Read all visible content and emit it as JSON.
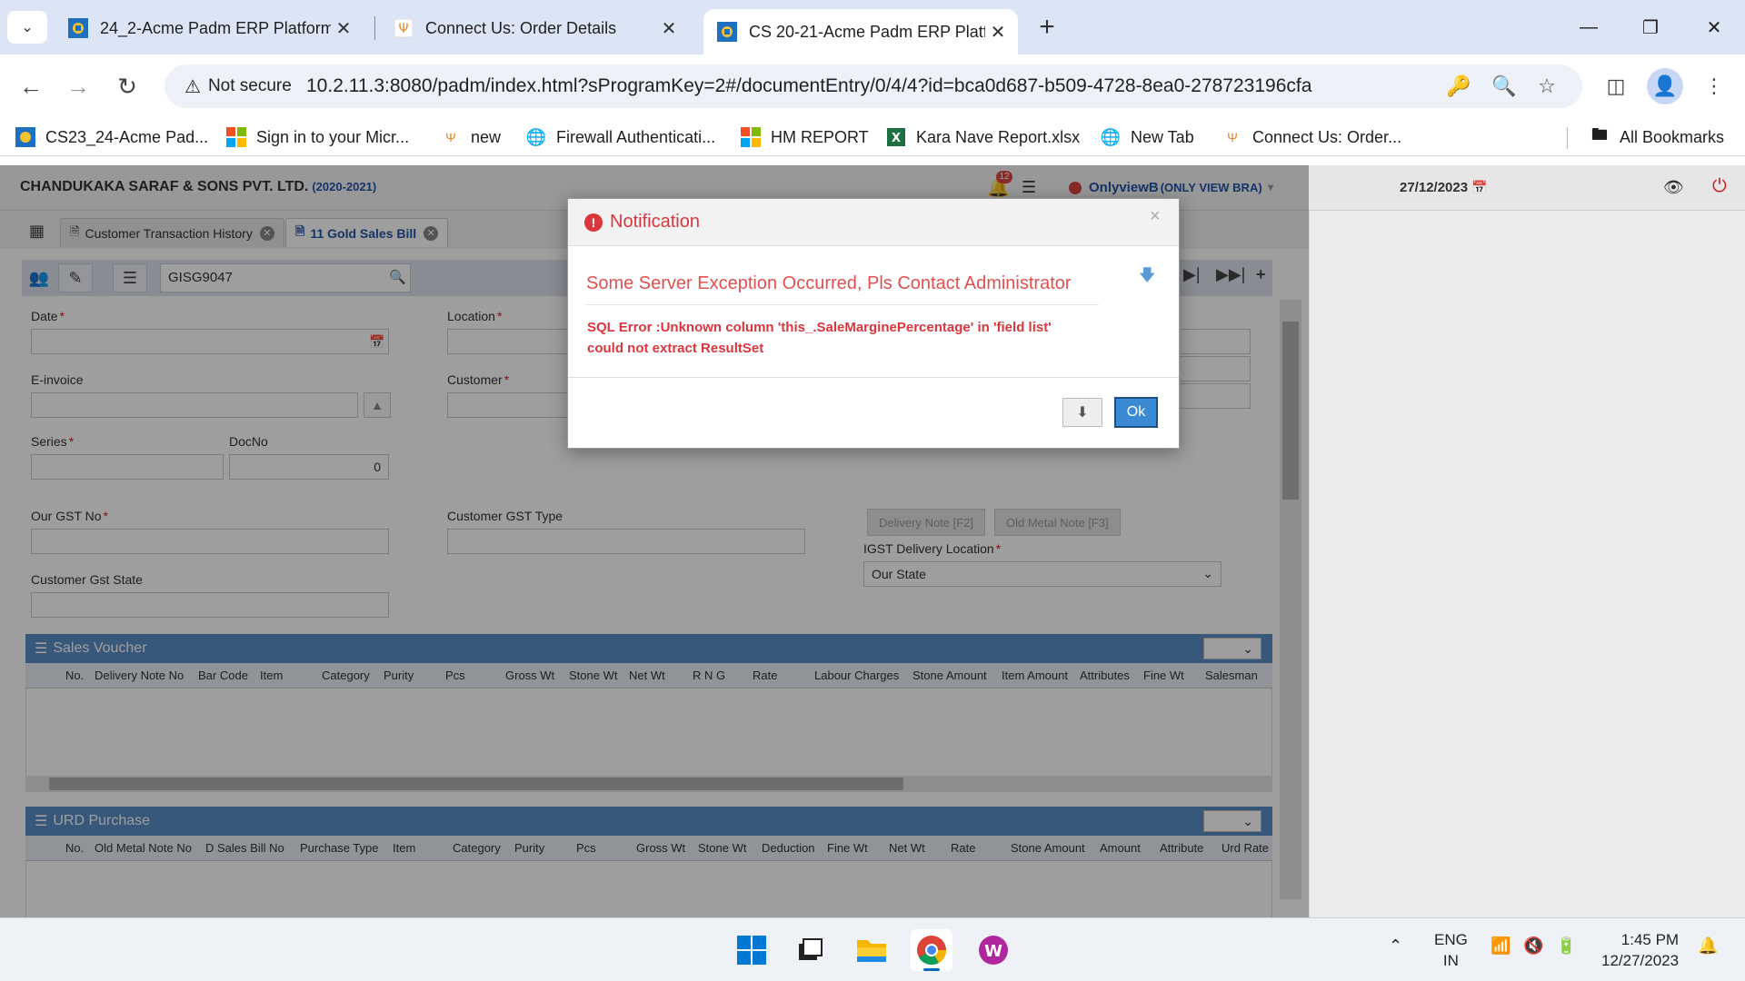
{
  "browser": {
    "tabs": [
      {
        "title": "24_2-Acme Padm ERP Platform"
      },
      {
        "title": "Connect Us: Order Details"
      },
      {
        "title": "CS 20-21-Acme Padm ERP Platf"
      }
    ],
    "not_secure": "Not secure",
    "url": "10.2.11.3:8080/padm/index.html?sProgramKey=2#/documentEntry/0/4/4?id=bca0d687-b509-4728-8ea0-278723196cfa",
    "bookmarks": [
      {
        "label": "CS23_24-Acme Pad..."
      },
      {
        "label": "Sign in to your Micr..."
      },
      {
        "label": "new"
      },
      {
        "label": "Firewall Authenticati..."
      },
      {
        "label": "HM REPORT"
      },
      {
        "label": "Kara Nave Report.xlsx"
      },
      {
        "label": "New Tab"
      },
      {
        "label": "Connect Us: Order..."
      }
    ],
    "all_bookmarks": "All Bookmarks"
  },
  "app": {
    "company": "CHANDUKAKA SARAF & SONS PVT. LTD.",
    "year": "(2020-2021)",
    "notification_count": "12",
    "user": "OnlyviewB",
    "user_role": "(ONLY VIEW BRA)",
    "date": "27/12/2023",
    "tabs": [
      {
        "label": "Customer Transaction History"
      },
      {
        "label": "11 Gold Sales Bill"
      }
    ],
    "doc_search": "GISG9047"
  },
  "form": {
    "date_label": "Date",
    "location_label": "Location",
    "einvoice_label": "E-invoice",
    "customer_label": "Customer",
    "series_label": "Series",
    "docno_label": "DocNo",
    "docno_value": "0",
    "our_gst_label": "Our GST No",
    "customer_gst_type_label": "Customer GST Type",
    "customer_gst_state_label": "Customer Gst State",
    "delivery_note_btn": "Delivery Note [F2]",
    "old_metal_note_btn": "Old Metal Note [F3]",
    "igst_label": "IGST Delivery Location",
    "igst_value": "Our State"
  },
  "sales_voucher": {
    "title": "Sales Voucher",
    "columns": [
      "No.",
      "Delivery Note No",
      "Bar Code",
      "Item",
      "Category",
      "Purity",
      "Pcs",
      "Gross Wt",
      "Stone Wt",
      "Net Wt",
      "R N G",
      "Rate",
      "Labour Charges",
      "Stone Amount",
      "Item Amount",
      "Attributes",
      "Fine Wt",
      "Salesman"
    ]
  },
  "urd_purchase": {
    "title": "URD Purchase",
    "columns": [
      "No.",
      "Old Metal Note No",
      "D Sales Bill No",
      "Purchase Type",
      "Item",
      "Category",
      "Purity",
      "Pcs",
      "Gross Wt",
      "Stone Wt",
      "Deduction",
      "Fine Wt",
      "Net Wt",
      "Rate",
      "Stone Amount",
      "Amount",
      "Attribute",
      "Urd Rate"
    ]
  },
  "modal": {
    "title": "Notification",
    "message": "Some Server Exception Occurred, Pls Contact Administrator",
    "error_line1": "SQL Error :Unknown column 'this_.SaleMarginePercentage' in 'field list'",
    "error_line2": "could not extract ResultSet",
    "ok_label": "Ok"
  },
  "taskbar": {
    "lang_line1": "ENG",
    "lang_line2": "IN",
    "time": "1:45 PM",
    "date": "12/27/2023"
  },
  "colors": {
    "accent": "#3a8bd4",
    "error": "#d9363e",
    "section_header": "#5b8fc7"
  }
}
